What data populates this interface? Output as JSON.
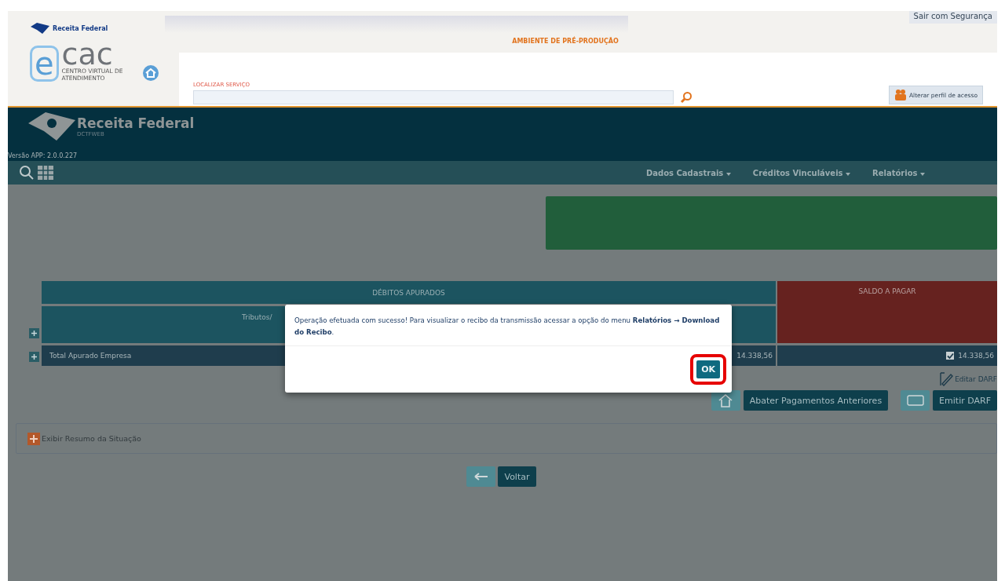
{
  "header": {
    "agency": "Receita Federal",
    "ecac_logo": {
      "mark": "e",
      "word": "cac",
      "subtitle": "CENTRO VIRTUAL DE ATENDIMENTO"
    },
    "environment": "AMBIENTE DE PRÉ-PRODUÇÃO",
    "logout": "Sair com Segurança",
    "search": {
      "label": "LOCALIZAR SERVIÇO"
    },
    "profile_button": "Alterar perfil de acesso"
  },
  "brand": {
    "name": "Receita Federal",
    "product": "DCTFWEB",
    "version": "Versão APP: 2.0.0.227"
  },
  "nav": {
    "menus": [
      {
        "label": "Dados Cadastrais"
      },
      {
        "label": "Créditos Vinculáveis"
      },
      {
        "label": "Relatórios"
      }
    ]
  },
  "table": {
    "debits_header": "DÉBITOS APURADOS",
    "balance_header": "SALDO A PAGAR",
    "column_header": "Tributos/",
    "total_row": {
      "label": "Total Apurado Empresa",
      "debit": "14.338,56",
      "balance": "14.338,56",
      "checked": true
    }
  },
  "actions": {
    "edit_link": "Editar DARF",
    "deduct_button": "Abater Pagamentos Anteriores",
    "issue_button": "Emitir DARF"
  },
  "summary": {
    "label": "Exibir Resumo da Situação"
  },
  "back_button": "Voltar",
  "modal": {
    "message": "Operação efetuada com sucesso! Para visualizar o recibo da transmissão acessar a opção do menu **Relatórios → Download do Recibo**.",
    "ok": "OK",
    "highlighted": true
  }
}
